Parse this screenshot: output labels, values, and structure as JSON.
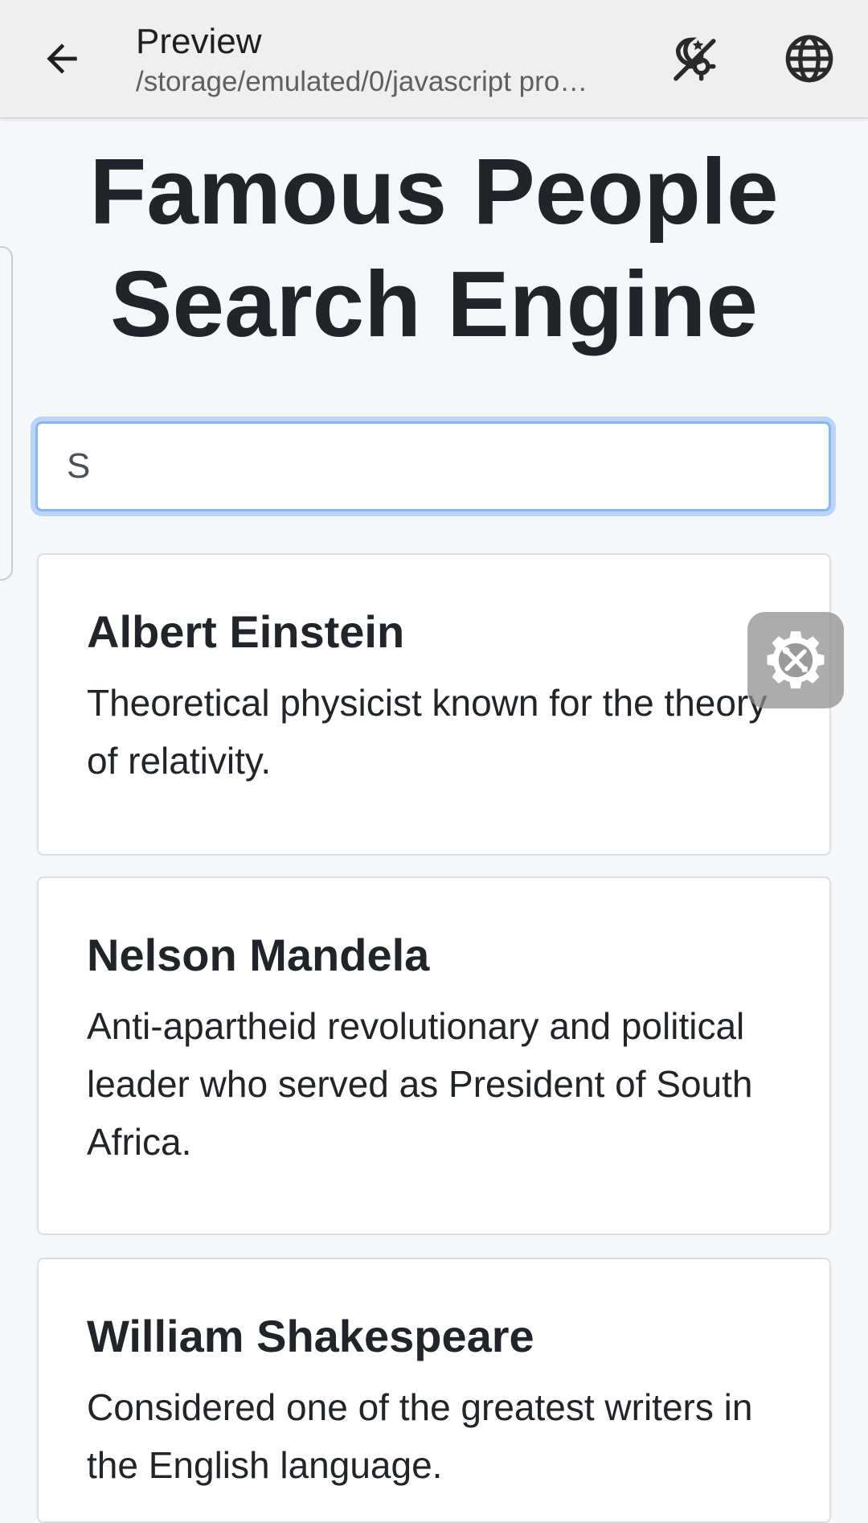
{
  "appbar": {
    "title": "Preview",
    "subtitle": "/storage/emulated/0/javascript pro…",
    "icons": [
      "arrow-left-icon",
      "theme-toggle-icon",
      "globe-icon"
    ]
  },
  "page": {
    "heading": "Famous People Search Engine",
    "search_value": "S"
  },
  "results": [
    {
      "name": "Albert Einstein",
      "description": "Theoretical physicist known for the theory of relativity."
    },
    {
      "name": "Nelson Mandela",
      "description": "Anti-apartheid revolutionary and political leader who served as President of South Africa."
    },
    {
      "name": "William Shakespeare",
      "description": "Considered one of the greatest writers in the English language."
    }
  ],
  "floating_button": {
    "icon": "tools-gear-icon"
  },
  "colors": {
    "appbar_bg": "#efefef",
    "page_bg": "#f6f7f9",
    "focus_ring": "#86b7fe",
    "text": "#212529"
  }
}
